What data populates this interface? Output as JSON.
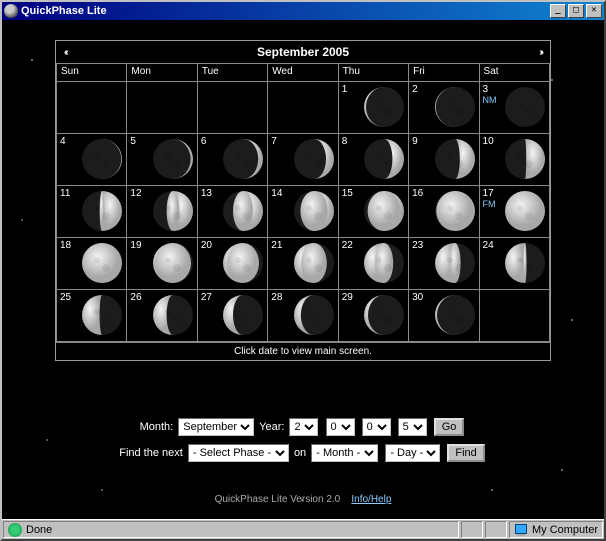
{
  "window": {
    "title": "QuickPhase Lite"
  },
  "calendar": {
    "title": "September 2005",
    "prev": "‹‹",
    "next": "››",
    "weekdays": [
      "Sun",
      "Mon",
      "Tue",
      "Wed",
      "Thu",
      "Fri",
      "Sat"
    ],
    "weeks": [
      [
        {
          "day": "",
          "illum": null
        },
        {
          "day": "",
          "illum": null
        },
        {
          "day": "",
          "illum": null
        },
        {
          "day": "",
          "illum": null
        },
        {
          "day": "1",
          "illum": -0.05,
          "label": ""
        },
        {
          "day": "2",
          "illum": -0.02,
          "label": ""
        },
        {
          "day": "3",
          "illum": 0.0,
          "label": "NM"
        }
      ],
      [
        {
          "day": "4",
          "illum": 0.02
        },
        {
          "day": "5",
          "illum": 0.06
        },
        {
          "day": "6",
          "illum": 0.12
        },
        {
          "day": "7",
          "illum": 0.2
        },
        {
          "day": "8",
          "illum": 0.29
        },
        {
          "day": "9",
          "illum": 0.38
        },
        {
          "day": "10",
          "illum": 0.47
        }
      ],
      [
        {
          "day": "11",
          "illum": 0.56
        },
        {
          "day": "12",
          "illum": 0.66
        },
        {
          "day": "13",
          "illum": 0.75
        },
        {
          "day": "14",
          "illum": 0.84
        },
        {
          "day": "15",
          "illum": 0.91
        },
        {
          "day": "16",
          "illum": 0.97
        },
        {
          "day": "17",
          "illum": 1.0,
          "label": "FM"
        }
      ],
      [
        {
          "day": "18",
          "illum": -0.99
        },
        {
          "day": "19",
          "illum": -0.95
        },
        {
          "day": "20",
          "illum": -0.9
        },
        {
          "day": "21",
          "illum": -0.82
        },
        {
          "day": "22",
          "illum": -0.73
        },
        {
          "day": "23",
          "illum": -0.64
        },
        {
          "day": "24",
          "illum": -0.54
        }
      ],
      [
        {
          "day": "25",
          "illum": -0.44
        },
        {
          "day": "26",
          "illum": -0.34
        },
        {
          "day": "27",
          "illum": -0.25
        },
        {
          "day": "28",
          "illum": -0.17
        },
        {
          "day": "29",
          "illum": -0.1
        },
        {
          "day": "30",
          "illum": -0.05
        },
        {
          "day": "",
          "illum": null
        }
      ]
    ],
    "footer_hint": "Click date to view main screen."
  },
  "controls": {
    "month_label": "Month:",
    "year_label": "Year:",
    "month_select": "September",
    "year_digits": [
      "2",
      "0",
      "0",
      "5"
    ],
    "go_label": "Go",
    "find_label": "Find the next",
    "phase_select": "- Select Phase -",
    "on_label": "on",
    "month_placeholder": "- Month -",
    "day_placeholder": "- Day -",
    "find_button": "Find"
  },
  "version": {
    "text": "QuickPhase Lite Version 2.0",
    "link": "Info/Help"
  },
  "status": {
    "left": "Done",
    "right": "My Computer"
  }
}
